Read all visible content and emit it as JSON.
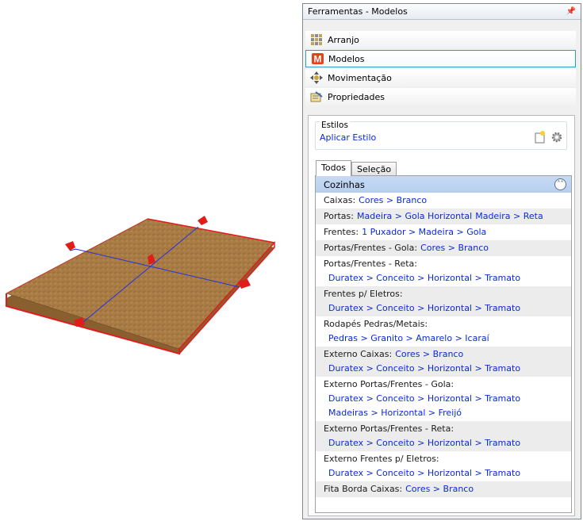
{
  "panel": {
    "title": "Ferramentas - Modelos",
    "pin_glyph": "→"
  },
  "menu": [
    {
      "label": "Arranjo",
      "icon": "grid-icon"
    },
    {
      "label": "Modelos",
      "icon": "m-icon",
      "selected": true
    },
    {
      "label": "Movimentação",
      "icon": "move-icon"
    },
    {
      "label": "Propriedades",
      "icon": "properties-icon"
    }
  ],
  "estilos": {
    "label": "Estilos",
    "link": "Aplicar Estilo"
  },
  "tabs": [
    "Todos",
    "Seleção"
  ],
  "section": {
    "title": "Cozinhas",
    "collapse_glyph": "˄˄"
  },
  "rows": [
    {
      "label": "Caixas:",
      "inline": [
        "Cores > Branco"
      ],
      "lines": []
    },
    {
      "label": "Portas:",
      "inline": [
        "Madeira > Gola Horizontal",
        "Madeira > Reta"
      ],
      "lines": []
    },
    {
      "label": "Frentes:",
      "inline": [
        "1 Puxador > Madeira > Gola"
      ],
      "lines": []
    },
    {
      "label": "Portas/Frentes - Gola:",
      "inline": [
        "Cores > Branco"
      ],
      "lines": []
    },
    {
      "label": "Portas/Frentes - Reta:",
      "inline": [],
      "lines": [
        "Duratex > Conceito > Horizontal > Tramato"
      ]
    },
    {
      "label": "Frentes p/ Eletros:",
      "inline": [],
      "lines": [
        "Duratex > Conceito > Horizontal > Tramato"
      ]
    },
    {
      "label": "Rodapés Pedras/Metais:",
      "inline": [],
      "lines": [
        "Pedras > Granito > Amarelo > Icaraí"
      ]
    },
    {
      "label": "Externo Caixas:",
      "inline": [
        "Cores > Branco"
      ],
      "lines": [
        "Duratex > Conceito > Horizontal > Tramato"
      ]
    },
    {
      "label": "Externo Portas/Frentes - Gola:",
      "inline": [],
      "lines": [
        "Duratex > Conceito > Horizontal > Tramato",
        "Madeiras > Horizontal > Freijó"
      ]
    },
    {
      "label": "Externo Portas/Frentes - Reta:",
      "inline": [],
      "lines": [
        "Duratex > Conceito > Horizontal > Tramato"
      ]
    },
    {
      "label": "Externo Frentes p/ Eletros:",
      "inline": [],
      "lines": [
        "Duratex > Conceito > Horizontal > Tramato"
      ]
    },
    {
      "label": "Fita Borda Caixas:",
      "inline": [
        "Cores > Branco"
      ],
      "lines": []
    }
  ],
  "colors": {
    "link": "#0a2bd4",
    "header": "#b7cff0",
    "accent_red": "#e21b1b",
    "guide_blue": "#2233dd",
    "wood": "#a87a44"
  }
}
